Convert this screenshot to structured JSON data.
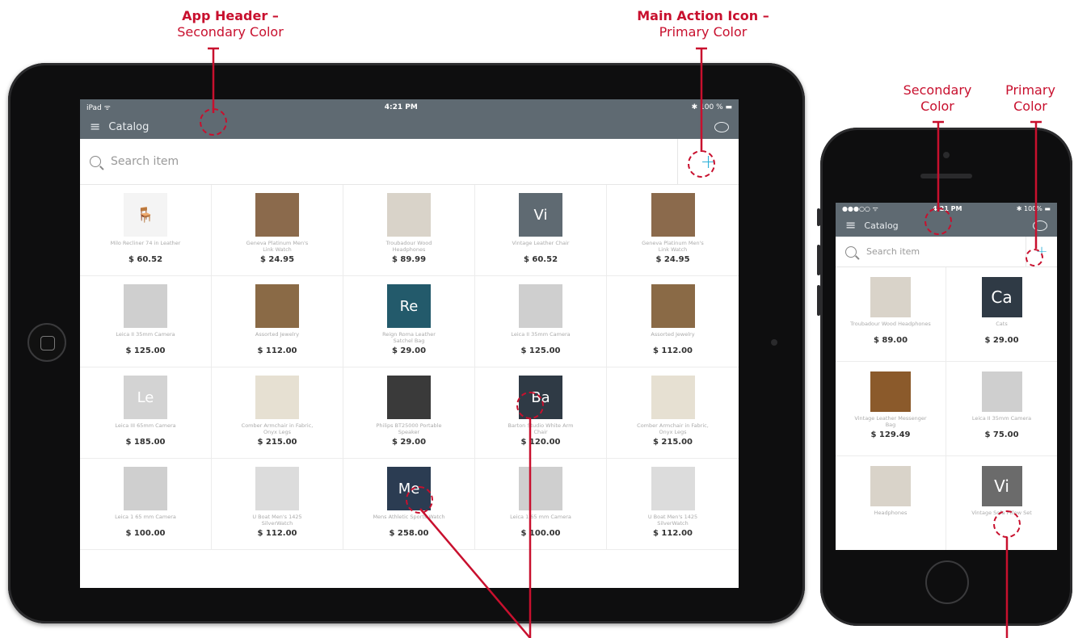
{
  "annotations": {
    "header": {
      "bold": "App Header –",
      "normal": "Secondary Color"
    },
    "action": {
      "bold": "Main Action Icon –",
      "normal": "Primary Color"
    },
    "secondary": {
      "line1": "Secondary",
      "line2": "Color"
    },
    "primary": {
      "line1": "Primary",
      "line2": "Color"
    }
  },
  "colors": {
    "secondary": "#5f6a72",
    "primary": "#2fb1d8",
    "annotation": "#c8102e"
  },
  "ipad": {
    "status": {
      "left": "iPad ᯤ",
      "time": "4:21 PM",
      "right": "✱ 100 % ▬"
    },
    "header": {
      "menu_icon": "≡",
      "title": "Catalog",
      "chat_icon": "speech-bubble-icon"
    },
    "search": {
      "placeholder": "Search item",
      "add_icon": "+"
    },
    "items": [
      {
        "name": "Milo Recliner 74 in Leather",
        "price": "$ 60.52",
        "color": "#f4f4f4",
        "initials": "🪑"
      },
      {
        "name": "Geneva Platinum Men's Link Watch",
        "price": "$ 24.95",
        "color": "#8b6a4c",
        "initials": ""
      },
      {
        "name": "Troubadour Wood Headphones",
        "price": "$ 89.99",
        "color": "#d9d3c9",
        "initials": ""
      },
      {
        "name": "Vintage Leather Chair",
        "price": "$ 60.52",
        "color": "#5f6a72",
        "initials": "Vi"
      },
      {
        "name": "Geneva Platinum Men's Link Watch",
        "price": "$ 24.95",
        "color": "#8b6a4c",
        "initials": ""
      },
      {
        "name": "Leica II 35mm Camera",
        "price": "$ 125.00",
        "color": "#cfcfcf",
        "initials": ""
      },
      {
        "name": "Assorted Jewelry",
        "price": "$ 112.00",
        "color": "#8a6a46",
        "initials": ""
      },
      {
        "name": "Reign Roma Leather Satchel Bag",
        "price": "$ 29.00",
        "color": "#235a6b",
        "initials": "Re"
      },
      {
        "name": "Leica II 35mm Camera",
        "price": "$ 125.00",
        "color": "#cfcfcf",
        "initials": ""
      },
      {
        "name": "Assorted Jewelry",
        "price": "$ 112.00",
        "color": "#8a6a46",
        "initials": ""
      },
      {
        "name": "Leica III 65mm Camera",
        "price": "$ 185.00",
        "color": "#d3d3d3",
        "initials": "Le"
      },
      {
        "name": "Comber Armchair in Fabric, Onyx Legs",
        "price": "$ 215.00",
        "color": "#e6e0d2",
        "initials": ""
      },
      {
        "name": "Philips BT25000 Portable Speaker",
        "price": "$ 29.00",
        "color": "#3a3a3a",
        "initials": ""
      },
      {
        "name": "Barton Studio White Arm Chair",
        "price": "$ 120.00",
        "color": "#2f3a45",
        "initials": "Ba"
      },
      {
        "name": "Comber Armchair in Fabric, Onyx Legs",
        "price": "$ 215.00",
        "color": "#e6e0d2",
        "initials": ""
      },
      {
        "name": "Leica 1 65 mm Camera",
        "price": "$ 100.00",
        "color": "#cfcfcf",
        "initials": ""
      },
      {
        "name": "U Boat Men's 1425 SilverWatch",
        "price": "$ 112.00",
        "color": "#dcdcdc",
        "initials": ""
      },
      {
        "name": "Mens Athletic Sports Watch",
        "price": "$ 258.00",
        "color": "#2b3c52",
        "initials": "Me"
      },
      {
        "name": "Leica 1 65 mm Camera",
        "price": "$ 100.00",
        "color": "#cfcfcf",
        "initials": ""
      },
      {
        "name": "U Boat Men's 1425 SilverWatch",
        "price": "$ 112.00",
        "color": "#dcdcdc",
        "initials": ""
      }
    ]
  },
  "iphone": {
    "status": {
      "left": "●●●○○ ᯤ",
      "time": "4:21 PM",
      "right": "✱ 100% ▬"
    },
    "header": {
      "menu_icon": "≡",
      "title": "Catalog"
    },
    "search": {
      "placeholder": "Search item",
      "add_icon": "+"
    },
    "items": [
      {
        "name": "Troubadour Wood Headphones",
        "price": "$ 89.00",
        "color": "#d9d3c9",
        "initials": ""
      },
      {
        "name": "Cats",
        "price": "$ 29.00",
        "color": "#2f3a45",
        "initials": "Ca"
      },
      {
        "name": "Vintage Leather Messenger Bag",
        "price": "$ 129.49",
        "color": "#8b5a2b",
        "initials": ""
      },
      {
        "name": "Leica II 35mm Camera",
        "price": "$ 75.00",
        "color": "#cfcfcf",
        "initials": ""
      },
      {
        "name": "Headphones",
        "price": "",
        "color": "#d9d3c9",
        "initials": ""
      },
      {
        "name": "Vintage Sofa Pillow Set",
        "price": "",
        "color": "#6b6b6b",
        "initials": "Vi"
      }
    ]
  }
}
